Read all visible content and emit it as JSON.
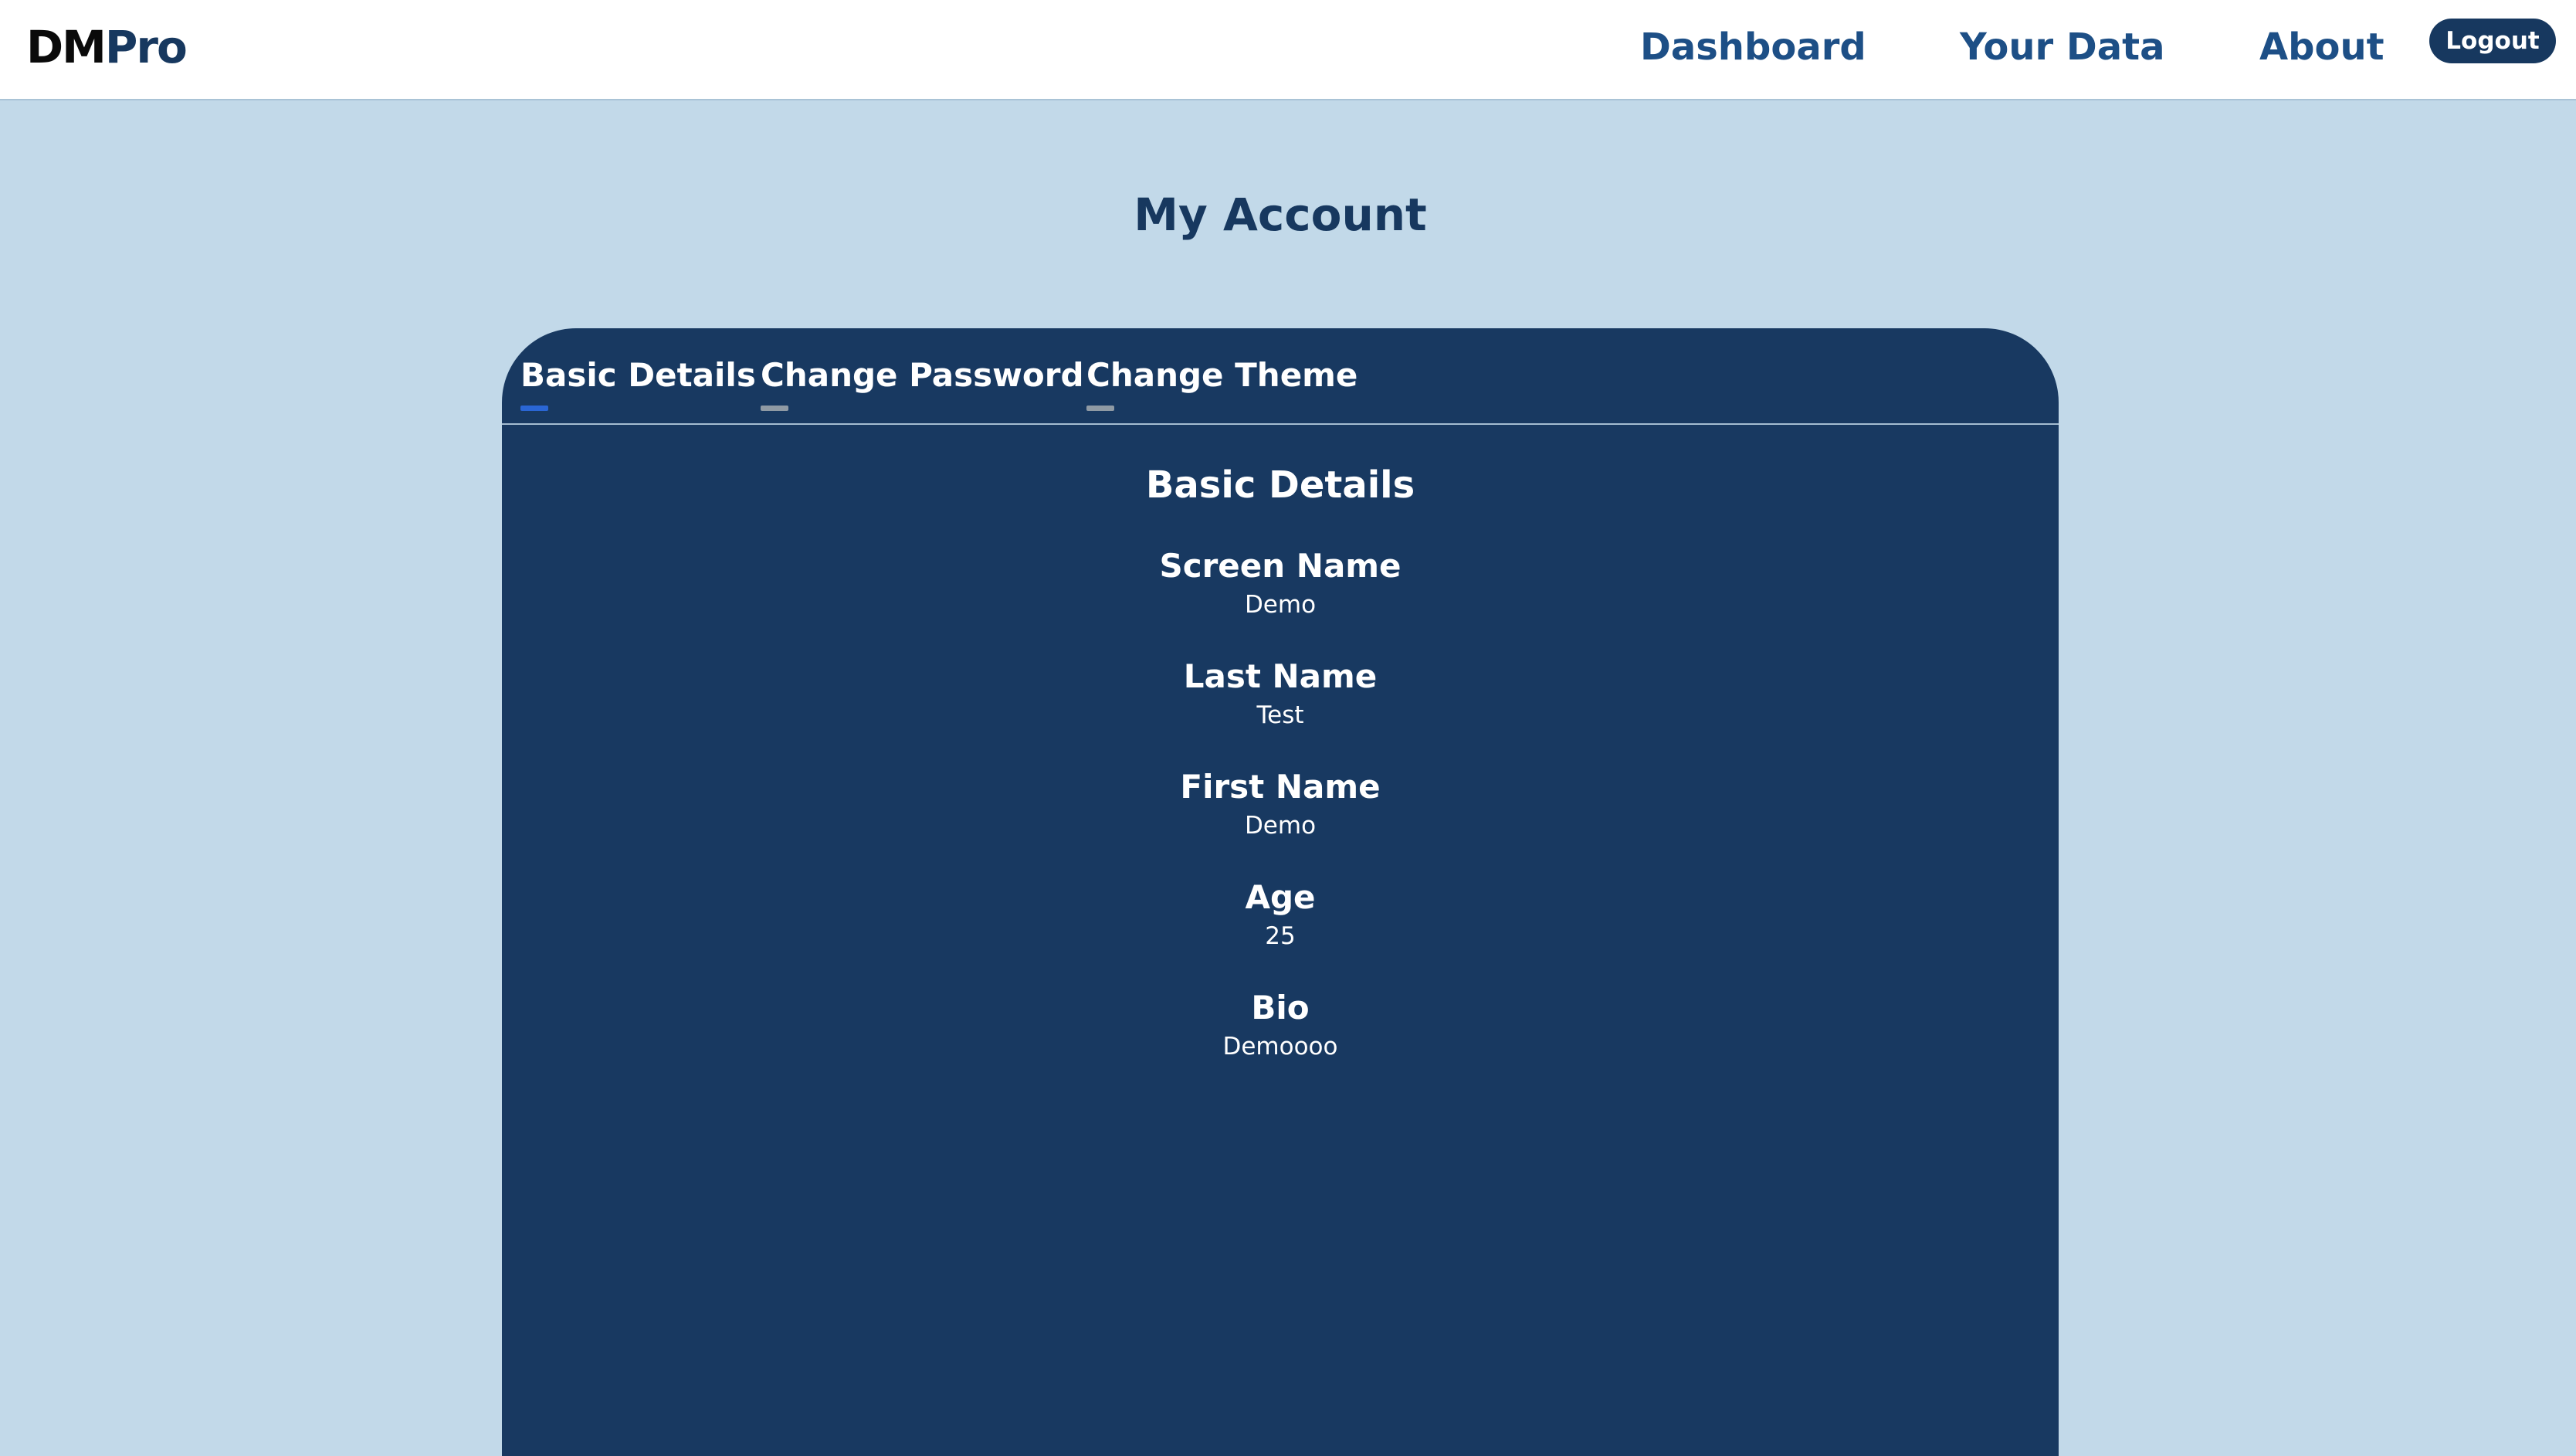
{
  "navbar": {
    "logo_part1": "DM",
    "logo_part2": "Pro",
    "links": [
      "Dashboard",
      "Your Data",
      "About"
    ],
    "logout_label": "Logout"
  },
  "page": {
    "title": "My Account"
  },
  "tabs": [
    {
      "label": "Basic Details",
      "active": true
    },
    {
      "label": "Change Password",
      "active": false
    },
    {
      "label": "Change Theme",
      "active": false
    }
  ],
  "section": {
    "title": "Basic Details",
    "fields": [
      {
        "label": "Screen Name",
        "value": "Demo"
      },
      {
        "label": "Last Name",
        "value": "Test"
      },
      {
        "label": "First Name",
        "value": "Demo"
      },
      {
        "label": "Age",
        "value": "25"
      },
      {
        "label": "Bio",
        "value": "Demoooo"
      }
    ]
  },
  "colors": {
    "background": "#c2d9e9",
    "card": "#183961",
    "nav_link": "#1d4f86",
    "active_tab_indicator": "#2a66d4",
    "inactive_tab_indicator": "#8f9aa4"
  }
}
